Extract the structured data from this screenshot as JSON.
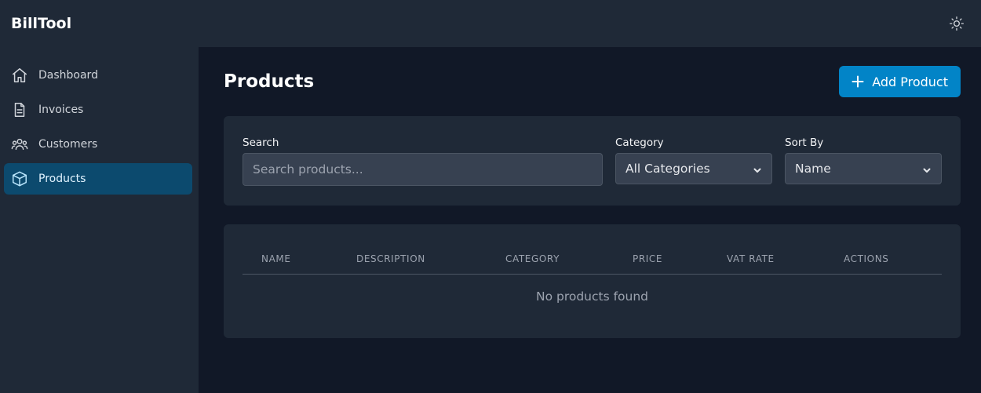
{
  "app": {
    "name": "BillTool"
  },
  "sidebar": {
    "items": [
      {
        "label": "Dashboard",
        "icon": "home-icon"
      },
      {
        "label": "Invoices",
        "icon": "file-icon"
      },
      {
        "label": "Customers",
        "icon": "users-icon"
      },
      {
        "label": "Products",
        "icon": "cube-icon",
        "active": true
      }
    ]
  },
  "topbar": {
    "theme_toggle_icon": "sun-icon"
  },
  "page": {
    "title": "Products",
    "add_button_label": "Add Product",
    "add_button_icon": "plus-icon"
  },
  "filters": {
    "search_label": "Search",
    "search_placeholder": "Search products...",
    "search_value": "",
    "category_label": "Category",
    "category_selected": "All Categories",
    "sort_label": "Sort By",
    "sort_selected": "Name"
  },
  "table": {
    "columns": [
      "NAME",
      "DESCRIPTION",
      "CATEGORY",
      "PRICE",
      "VAT RATE",
      "ACTIONS"
    ],
    "empty_message": "No products found"
  },
  "colors": {
    "background": "#111827",
    "surface": "#1f2937",
    "accent": "#0284c7",
    "active_nav": "#0c4a6e"
  }
}
